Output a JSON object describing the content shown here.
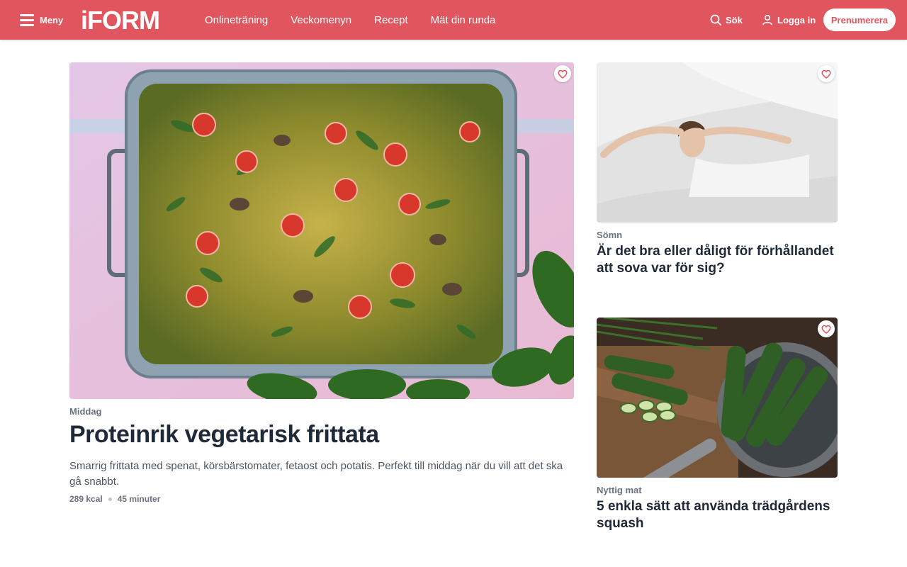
{
  "header": {
    "menu_label": "Meny",
    "logo_text": "iFORM",
    "nav": [
      "Onlineträning",
      "Veckomenyn",
      "Recept",
      "Mät din runda"
    ],
    "search_label": "Sök",
    "login_label": "Logga in",
    "subscribe_label": "Prenumerera"
  },
  "colors": {
    "brand": "#e0555e",
    "text": "#1f2937",
    "muted": "#6b7280"
  },
  "main_article": {
    "category": "Middag",
    "title": "Proteinrik vegetarisk frittata",
    "description": "Smarrig frittata med spenat, körsbärstomater, fetaost och potatis. Perfekt till middag när du vill att det ska gå snabbt.",
    "kcal": "289 kcal",
    "time": "45 minuter"
  },
  "side_articles": [
    {
      "category": "Sömn",
      "title": "Är det bra eller dåligt för förhållandet att sova var för sig?"
    },
    {
      "category": "Nyttig mat",
      "title": "5 enkla sätt att använda trädgårdens squash"
    }
  ]
}
